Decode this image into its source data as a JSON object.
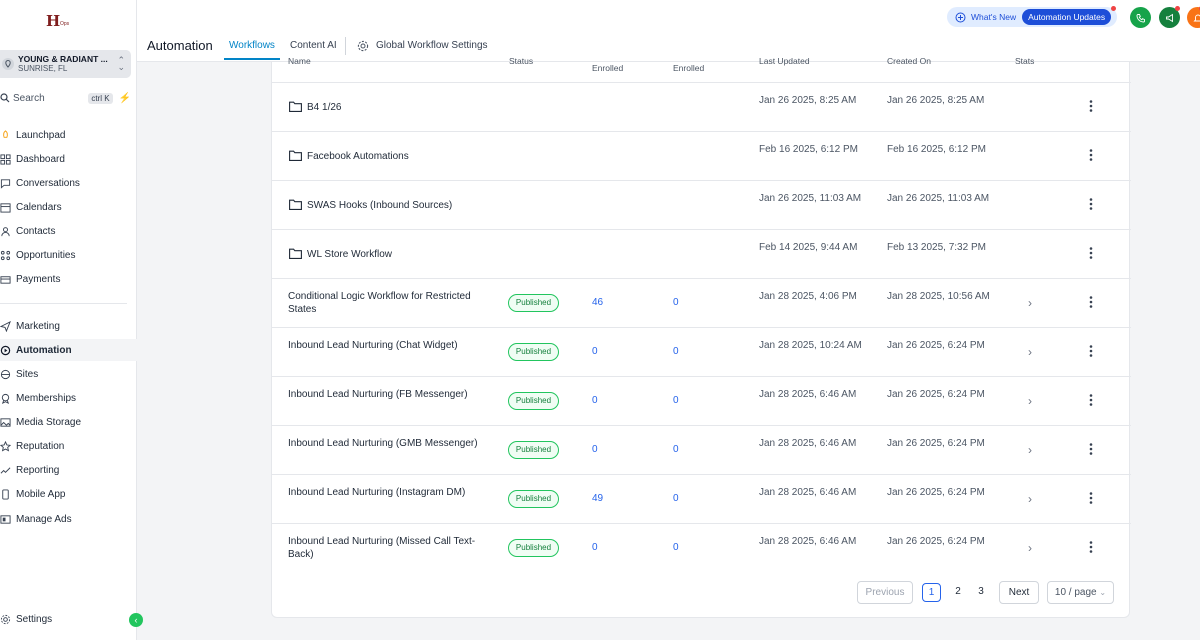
{
  "sidebar": {
    "logo_mark": "H",
    "logo_sub": "Ops",
    "location": {
      "name": "YOUNG & RADIANT ...",
      "city": "SUNRISE, FL"
    },
    "search": {
      "label": "Search",
      "shortcut": "ctrl K"
    },
    "items": [
      {
        "label": "Launchpad",
        "icon": "rocket-icon"
      },
      {
        "label": "Dashboard",
        "icon": "dashboard-icon"
      },
      {
        "label": "Conversations",
        "icon": "chat-icon"
      },
      {
        "label": "Calendars",
        "icon": "calendar-icon"
      },
      {
        "label": "Contacts",
        "icon": "contacts-icon"
      },
      {
        "label": "Opportunities",
        "icon": "opportunities-icon"
      },
      {
        "label": "Payments",
        "icon": "payments-icon"
      },
      {
        "label": "Marketing",
        "icon": "send-icon"
      },
      {
        "label": "Automation",
        "icon": "automation-icon"
      },
      {
        "label": "Sites",
        "icon": "sites-icon"
      },
      {
        "label": "Memberships",
        "icon": "memberships-icon"
      },
      {
        "label": "Media Storage",
        "icon": "media-icon"
      },
      {
        "label": "Reputation",
        "icon": "star-icon"
      },
      {
        "label": "Reporting",
        "icon": "reporting-icon"
      },
      {
        "label": "Mobile App",
        "icon": "mobile-icon"
      },
      {
        "label": "Manage Ads",
        "icon": "ads-icon"
      }
    ],
    "settings_label": "Settings"
  },
  "header": {
    "title": "Automation",
    "tabs": [
      {
        "label": "Workflows",
        "active": true
      },
      {
        "label": "Content AI",
        "active": false
      },
      {
        "label": "Global Workflow Settings",
        "active": false
      }
    ],
    "whats_new": "What's New",
    "updates_badge": "Automation Updates"
  },
  "table": {
    "headers": {
      "name": "Name",
      "status": "Status",
      "total_enrolled": "Enrolled",
      "active_enrolled": "Enrolled",
      "last_updated": "Last Updated",
      "created_on": "Created On",
      "stats": "Stats"
    },
    "rows": [
      {
        "type": "folder",
        "name": "B4 1/26",
        "status": "",
        "total": "",
        "active": "",
        "updated": "Jan 26 2025, 8:25 AM",
        "created": "Jan 26 2025, 8:25 AM"
      },
      {
        "type": "folder",
        "name": "Facebook Automations",
        "status": "",
        "total": "",
        "active": "",
        "updated": "Feb 16 2025, 6:12 PM",
        "created": "Feb 16 2025, 6:12 PM"
      },
      {
        "type": "folder",
        "name": "SWAS Hooks (Inbound Sources)",
        "status": "",
        "total": "",
        "active": "",
        "updated": "Jan 26 2025, 11:03 AM",
        "created": "Jan 26 2025, 11:03 AM"
      },
      {
        "type": "folder",
        "name": "WL Store Workflow",
        "status": "",
        "total": "",
        "active": "",
        "updated": "Feb 14 2025, 9:44 AM",
        "created": "Feb 13 2025, 7:32 PM"
      },
      {
        "type": "workflow",
        "name": "Conditional Logic Workflow for Restricted States",
        "status": "Published",
        "total": "46",
        "active": "0",
        "updated": "Jan 28 2025, 4:06 PM",
        "created": "Jan 28 2025, 10:56 AM"
      },
      {
        "type": "workflow",
        "name": "Inbound Lead Nurturing (Chat Widget)",
        "status": "Published",
        "total": "0",
        "active": "0",
        "updated": "Jan 28 2025, 10:24 AM",
        "created": "Jan 26 2025, 6:24 PM"
      },
      {
        "type": "workflow",
        "name": "Inbound Lead Nurturing (FB Messenger)",
        "status": "Published",
        "total": "0",
        "active": "0",
        "updated": "Jan 28 2025, 6:46 AM",
        "created": "Jan 26 2025, 6:24 PM"
      },
      {
        "type": "workflow",
        "name": "Inbound Lead Nurturing (GMB Messenger)",
        "status": "Published",
        "total": "0",
        "active": "0",
        "updated": "Jan 28 2025, 6:46 AM",
        "created": "Jan 26 2025, 6:24 PM"
      },
      {
        "type": "workflow",
        "name": "Inbound Lead Nurturing (Instagram DM)",
        "status": "Published",
        "total": "49",
        "active": "0",
        "updated": "Jan 28 2025, 6:46 AM",
        "created": "Jan 26 2025, 6:24 PM"
      },
      {
        "type": "workflow",
        "name": "Inbound Lead Nurturing (Missed Call Text-Back)",
        "status": "Published",
        "total": "0",
        "active": "0",
        "updated": "Jan 28 2025, 6:46 AM",
        "created": "Jan 26 2025, 6:24 PM"
      }
    ]
  },
  "pagination": {
    "previous": "Previous",
    "pages": [
      "1",
      "2",
      "3"
    ],
    "current_page": "1",
    "next": "Next",
    "page_size": "10 / page"
  },
  "colors": {
    "accent": "#0284c7",
    "link": "#2563eb",
    "published": "#22c55e",
    "phone_button": "#16a34a",
    "megaphone_button": "#15803d",
    "notification_button": "#f97316"
  }
}
